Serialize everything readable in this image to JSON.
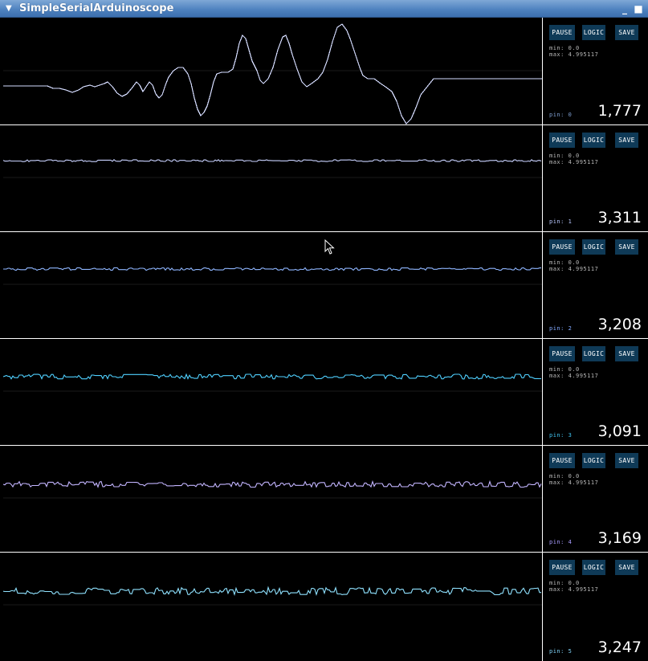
{
  "window": {
    "title": "SimpleSerialArduinoscope",
    "menu_icon": "triangle-down-icon",
    "minimize_icon": "minimize-icon",
    "close_icon": "close-icon"
  },
  "buttons": {
    "pause": "PAUSE",
    "logic": "LOGIC",
    "save": "SAVE"
  },
  "stats": {
    "min": "min: 0.0",
    "max": "max: 4.995117"
  },
  "colors": {
    "background": "#000000",
    "divider": "#ffffff",
    "button_bg": "#0f3a57",
    "pin_colors": [
      "#7f9fd1",
      "#b9c8ff",
      "#82a9ff",
      "#40c3f0",
      "#a89cff",
      "#7fd2f7"
    ]
  },
  "channels": [
    {
      "pin_label": "pin: 0",
      "count": "1,777",
      "trace_color": "#d5dcff"
    },
    {
      "pin_label": "pin: 1",
      "count": "3,311",
      "trace_color": "#c9d2ff"
    },
    {
      "pin_label": "pin: 2",
      "count": "3,208",
      "trace_color": "#8fb6ff"
    },
    {
      "pin_label": "pin: 3",
      "count": "3,091",
      "trace_color": "#4fd0ff"
    },
    {
      "pin_label": "pin: 4",
      "count": "3,169",
      "trace_color": "#c3b5ff"
    },
    {
      "pin_label": "pin: 5",
      "count": "3,247",
      "trace_color": "#8fe2ff"
    }
  ]
}
